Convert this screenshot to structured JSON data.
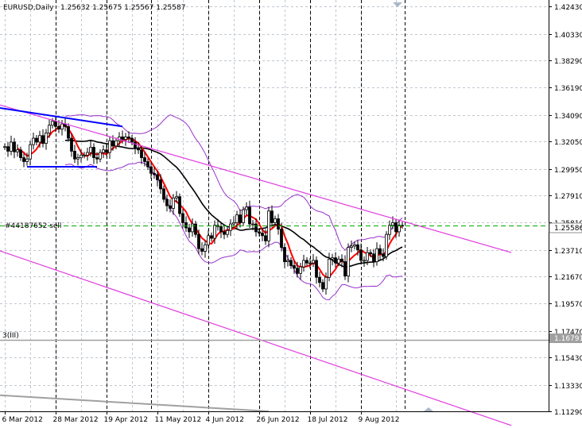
{
  "header": {
    "symbol": "EURUSD,Daily",
    "ohlc": "1.25632 1.25675 1.25567 1.25587"
  },
  "order_label": "#44187652 sell",
  "level_label": "3(III)",
  "price_tag_current": "1.25586",
  "price_tag_level": "1.16791",
  "colors": {
    "candle": "#000000",
    "grid": "#c0c8d0",
    "channel": "#e03ce0",
    "bands": "#9933cc",
    "fast_ma": "#ff0000",
    "slow_ma": "#000000",
    "trendline": "#0000ff",
    "order_line": "#00aa00",
    "level_line": "#a0a0a0",
    "vlines": "#000000"
  },
  "chart_data": {
    "type": "candlestick",
    "symbol": "EURUSD",
    "timeframe": "Daily",
    "ylim": [
      1.1129,
      1.4293
    ],
    "yticks": [
      "1.42430",
      "1.40330",
      "1.38290",
      "1.36190",
      "1.34090",
      "1.32050",
      "1.29950",
      "1.27910",
      "1.25810",
      "1.23710",
      "1.21670",
      "1.19570",
      "1.17470",
      "1.15430",
      "1.13330",
      "1.11290"
    ],
    "ytick_values": [
      1.4243,
      1.4033,
      1.3829,
      1.3619,
      1.3409,
      1.3205,
      1.2995,
      1.2791,
      1.2581,
      1.2371,
      1.2167,
      1.1957,
      1.1747,
      1.1543,
      1.1333,
      1.1129
    ],
    "xlim": [
      "2012-03-06",
      "2012-08-30"
    ],
    "xticks": [
      {
        "label": "6 Mar 2012",
        "date": "2012-03-06"
      },
      {
        "label": "28 Mar 2012",
        "date": "2012-03-28"
      },
      {
        "label": "19 Apr 2012",
        "date": "2012-04-19"
      },
      {
        "label": "11 May 2012",
        "date": "2012-05-11"
      },
      {
        "label": "4 Jun 2012",
        "date": "2012-06-04"
      },
      {
        "label": "26 Jun 2012",
        "date": "2012-06-26"
      },
      {
        "label": "18 Jul 2012",
        "date": "2012-07-18"
      },
      {
        "label": "9 Aug 2012",
        "date": "2012-08-09"
      }
    ],
    "close_series": [
      [
        "2012-03-06",
        1.3165
      ],
      [
        "2012-03-07",
        1.313
      ],
      [
        "2012-03-08",
        1.32
      ],
      [
        "2012-03-09",
        1.3125
      ],
      [
        "2012-03-12",
        1.314
      ],
      [
        "2012-03-13",
        1.308
      ],
      [
        "2012-03-14",
        1.305
      ],
      [
        "2012-03-15",
        1.307
      ],
      [
        "2012-03-16",
        1.318
      ],
      [
        "2012-03-19",
        1.323
      ],
      [
        "2012-03-20",
        1.32
      ],
      [
        "2012-03-21",
        1.325
      ],
      [
        "2012-03-22",
        1.319
      ],
      [
        "2012-03-23",
        1.327
      ],
      [
        "2012-03-26",
        1.333
      ],
      [
        "2012-03-27",
        1.336
      ],
      [
        "2012-03-28",
        1.332
      ],
      [
        "2012-03-29",
        1.33
      ],
      [
        "2012-03-30",
        1.334
      ],
      [
        "2012-04-02",
        1.332
      ],
      [
        "2012-04-03",
        1.323
      ],
      [
        "2012-04-04",
        1.313
      ],
      [
        "2012-04-05",
        1.307
      ],
      [
        "2012-04-06",
        1.308
      ],
      [
        "2012-04-09",
        1.31
      ],
      [
        "2012-04-10",
        1.31
      ],
      [
        "2012-04-11",
        1.312
      ],
      [
        "2012-04-12",
        1.316
      ],
      [
        "2012-04-13",
        1.308
      ],
      [
        "2012-04-16",
        1.307
      ],
      [
        "2012-04-17",
        1.312
      ],
      [
        "2012-04-18",
        1.314
      ],
      [
        "2012-04-19",
        1.312
      ],
      [
        "2012-04-20",
        1.321
      ],
      [
        "2012-04-23",
        1.317
      ],
      [
        "2012-04-24",
        1.321
      ],
      [
        "2012-04-25",
        1.324
      ],
      [
        "2012-04-26",
        1.322
      ],
      [
        "2012-04-27",
        1.324
      ],
      [
        "2012-04-30",
        1.323
      ],
      [
        "2012-05-01",
        1.32
      ],
      [
        "2012-05-02",
        1.315
      ],
      [
        "2012-05-03",
        1.314
      ],
      [
        "2012-05-04",
        1.308
      ],
      [
        "2012-05-07",
        1.305
      ],
      [
        "2012-05-08",
        1.301
      ],
      [
        "2012-05-09",
        1.296
      ],
      [
        "2012-05-10",
        1.295
      ],
      [
        "2012-05-11",
        1.291
      ],
      [
        "2012-05-14",
        1.284
      ],
      [
        "2012-05-15",
        1.276
      ],
      [
        "2012-05-16",
        1.271
      ],
      [
        "2012-05-17",
        1.269
      ],
      [
        "2012-05-18",
        1.277
      ],
      [
        "2012-05-21",
        1.278
      ],
      [
        "2012-05-22",
        1.265
      ],
      [
        "2012-05-23",
        1.258
      ],
      [
        "2012-05-24",
        1.254
      ],
      [
        "2012-05-25",
        1.251
      ],
      [
        "2012-05-28",
        1.257
      ],
      [
        "2012-05-29",
        1.249
      ],
      [
        "2012-05-30",
        1.238
      ],
      [
        "2012-05-31",
        1.236
      ],
      [
        "2012-06-01",
        1.241
      ],
      [
        "2012-06-04",
        1.248
      ],
      [
        "2012-06-05",
        1.246
      ],
      [
        "2012-06-06",
        1.256
      ],
      [
        "2012-06-07",
        1.255
      ],
      [
        "2012-06-08",
        1.251
      ],
      [
        "2012-06-11",
        1.249
      ],
      [
        "2012-06-12",
        1.252
      ],
      [
        "2012-06-13",
        1.257
      ],
      [
        "2012-06-14",
        1.258
      ],
      [
        "2012-06-15",
        1.264
      ],
      [
        "2012-06-18",
        1.258
      ],
      [
        "2012-06-19",
        1.268
      ],
      [
        "2012-06-20",
        1.27
      ],
      [
        "2012-06-21",
        1.257
      ],
      [
        "2012-06-22",
        1.257
      ],
      [
        "2012-06-25",
        1.251
      ],
      [
        "2012-06-26",
        1.25
      ],
      [
        "2012-06-27",
        1.248
      ],
      [
        "2012-06-28",
        1.244
      ],
      [
        "2012-06-29",
        1.267
      ],
      [
        "2012-07-02",
        1.258
      ],
      [
        "2012-07-03",
        1.261
      ],
      [
        "2012-07-04",
        1.253
      ],
      [
        "2012-07-05",
        1.239
      ],
      [
        "2012-07-06",
        1.228
      ],
      [
        "2012-07-09",
        1.229
      ],
      [
        "2012-07-10",
        1.225
      ],
      [
        "2012-07-11",
        1.223
      ],
      [
        "2012-07-12",
        1.219
      ],
      [
        "2012-07-13",
        1.224
      ],
      [
        "2012-07-16",
        1.229
      ],
      [
        "2012-07-17",
        1.227
      ],
      [
        "2012-07-18",
        1.227
      ],
      [
        "2012-07-19",
        1.229
      ],
      [
        "2012-07-20",
        1.216
      ],
      [
        "2012-07-23",
        1.212
      ],
      [
        "2012-07-24",
        1.207
      ],
      [
        "2012-07-25",
        1.216
      ],
      [
        "2012-07-26",
        1.23
      ],
      [
        "2012-07-27",
        1.231
      ],
      [
        "2012-07-30",
        1.227
      ],
      [
        "2012-07-31",
        1.23
      ],
      [
        "2012-08-01",
        1.228
      ],
      [
        "2012-08-02",
        1.217
      ],
      [
        "2012-08-03",
        1.239
      ],
      [
        "2012-08-06",
        1.24
      ],
      [
        "2012-08-07",
        1.241
      ],
      [
        "2012-08-08",
        1.237
      ],
      [
        "2012-08-09",
        1.229
      ],
      [
        "2012-08-10",
        1.229
      ],
      [
        "2012-08-13",
        1.235
      ],
      [
        "2012-08-14",
        1.234
      ],
      [
        "2012-08-15",
        1.228
      ],
      [
        "2012-08-16",
        1.238
      ],
      [
        "2012-08-17",
        1.234
      ],
      [
        "2012-08-20",
        1.232
      ],
      [
        "2012-08-21",
        1.249
      ],
      [
        "2012-08-22",
        1.256
      ],
      [
        "2012-08-23",
        1.258
      ],
      [
        "2012-08-24",
        1.251
      ],
      [
        "2012-08-27",
        1.256
      ],
      [
        "2012-08-28",
        1.2559
      ]
    ],
    "channel_lines": [
      {
        "from": [
          "2012-03-01",
          1.35
        ],
        "to": [
          "2012-10-15",
          1.235
        ]
      },
      {
        "from": [
          "2012-03-01",
          1.238
        ],
        "to": [
          "2012-10-15",
          1.102
        ]
      }
    ],
    "blue_trendlines": [
      {
        "from": [
          "2012-03-01",
          1.347
        ],
        "to": [
          "2012-04-26",
          1.332
        ]
      },
      {
        "from": [
          "2012-03-15",
          1.301
        ],
        "to": [
          "2012-04-16",
          1.301
        ]
      }
    ],
    "order_line": 1.2558,
    "level_line": 1.1679,
    "vertical_line_dates": [
      "2012-03-28",
      "2012-04-19",
      "2012-05-09",
      "2012-06-04",
      "2012-06-26",
      "2012-07-18",
      "2012-08-09",
      "2012-08-29"
    ]
  }
}
